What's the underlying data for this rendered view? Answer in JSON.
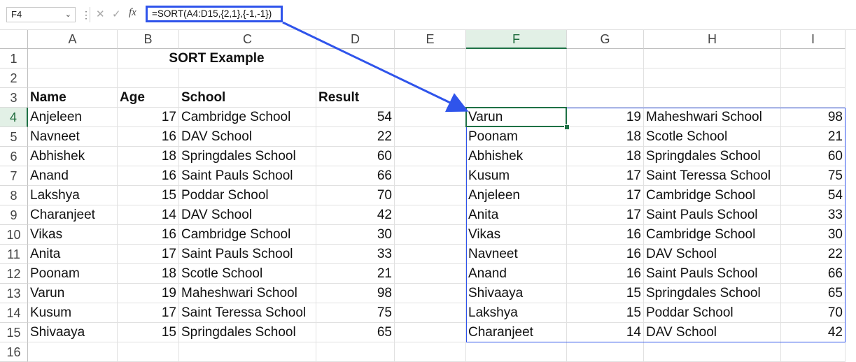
{
  "namebox": {
    "value": "F4"
  },
  "formula_bar": {
    "fx_label": "fx",
    "formula": "=SORT(A4:D15,{2,1},{-1,-1})"
  },
  "columns": [
    "A",
    "B",
    "C",
    "D",
    "E",
    "F",
    "G",
    "H",
    "I"
  ],
  "rows": [
    "1",
    "2",
    "3",
    "4",
    "5",
    "6",
    "7",
    "8",
    "9",
    "10",
    "11",
    "12",
    "13",
    "14",
    "15",
    "16"
  ],
  "title": "SORT Example",
  "headers": {
    "name": "Name",
    "age": "Age",
    "school": "School",
    "result": "Result"
  },
  "source": [
    [
      "Anjeleen",
      "17",
      "Cambridge School",
      "54"
    ],
    [
      "Navneet",
      "16",
      "DAV School",
      "22"
    ],
    [
      "Abhishek",
      "18",
      "Springdales School",
      "60"
    ],
    [
      "Anand",
      "16",
      "Saint Pauls School",
      "66"
    ],
    [
      "Lakshya",
      "15",
      "Poddar School",
      "70"
    ],
    [
      "Charanjeet",
      "14",
      "DAV School",
      "42"
    ],
    [
      "Vikas",
      "16",
      "Cambridge School",
      "30"
    ],
    [
      "Anita",
      "17",
      "Saint Pauls School",
      "33"
    ],
    [
      "Poonam",
      "18",
      "Scotle School",
      "21"
    ],
    [
      "Varun",
      "19",
      "Maheshwari School",
      "98"
    ],
    [
      "Kusum",
      "17",
      "Saint Teressa School",
      "75"
    ],
    [
      "Shivaaya",
      "15",
      "Springdales School",
      "65"
    ]
  ],
  "sorted": [
    [
      "Varun",
      "19",
      "Maheshwari School",
      "98"
    ],
    [
      "Poonam",
      "18",
      "Scotle School",
      "21"
    ],
    [
      "Abhishek",
      "18",
      "Springdales School",
      "60"
    ],
    [
      "Kusum",
      "17",
      "Saint Teressa School",
      "75"
    ],
    [
      "Anjeleen",
      "17",
      "Cambridge School",
      "54"
    ],
    [
      "Anita",
      "17",
      "Saint Pauls School",
      "33"
    ],
    [
      "Vikas",
      "16",
      "Cambridge School",
      "30"
    ],
    [
      "Navneet",
      "16",
      "DAV School",
      "22"
    ],
    [
      "Anand",
      "16",
      "Saint Pauls School",
      "66"
    ],
    [
      "Shivaaya",
      "15",
      "Springdales School",
      "65"
    ],
    [
      "Lakshya",
      "15",
      "Poddar School",
      "70"
    ],
    [
      "Charanjeet",
      "14",
      "DAV School",
      "42"
    ]
  ],
  "colors": {
    "accent_blue": "#2f54eb",
    "selection_green": "#1e7145"
  }
}
